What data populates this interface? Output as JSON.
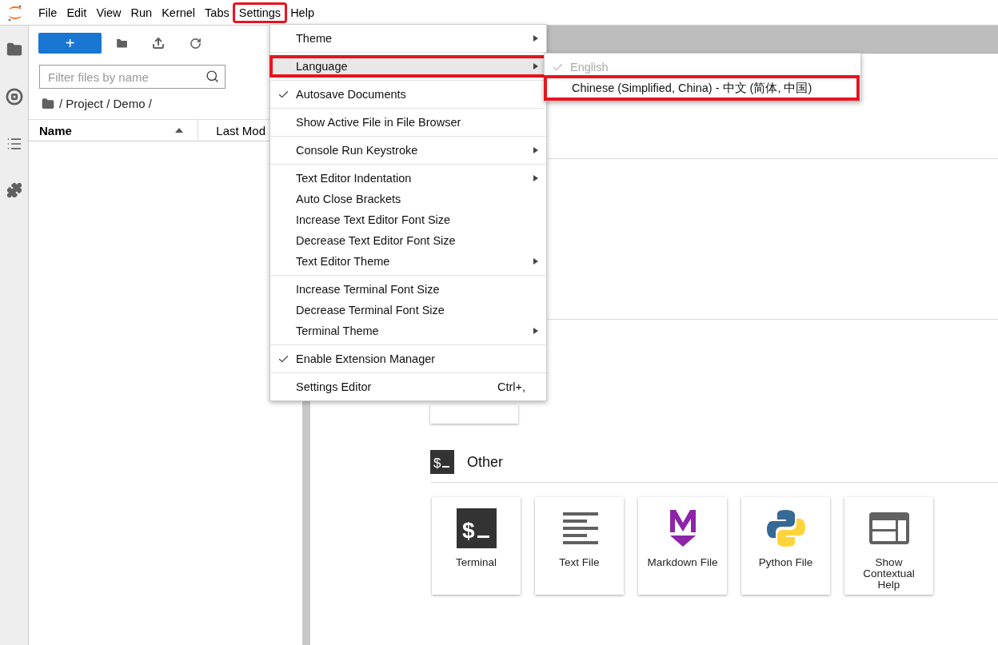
{
  "menubar": [
    {
      "label": "File",
      "highlighted": false
    },
    {
      "label": "Edit",
      "highlighted": false
    },
    {
      "label": "View",
      "highlighted": false
    },
    {
      "label": "Run",
      "highlighted": false
    },
    {
      "label": "Kernel",
      "highlighted": false
    },
    {
      "label": "Tabs",
      "highlighted": false
    },
    {
      "label": "Settings",
      "highlighted": true
    },
    {
      "label": "Help",
      "highlighted": false
    }
  ],
  "file_browser": {
    "new_button": "+",
    "filter": {
      "placeholder": "Filter files by name"
    },
    "breadcrumb": "/ Project / Demo /",
    "columns": [
      "Name",
      "Last Mod"
    ]
  },
  "settings_menu": [
    [
      {
        "label": "Theme",
        "checked": false,
        "submenu": true,
        "highlighted": false
      }
    ],
    [
      {
        "label": "Language",
        "checked": false,
        "submenu": true,
        "highlighted": true
      }
    ],
    [
      {
        "label": "Autosave Documents",
        "checked": true,
        "submenu": false,
        "highlighted": false
      }
    ],
    [
      {
        "label": "Show Active File in File Browser",
        "checked": false,
        "submenu": false,
        "highlighted": false
      }
    ],
    [
      {
        "label": "Console Run Keystroke",
        "checked": false,
        "submenu": true,
        "highlighted": false
      }
    ],
    [
      {
        "label": "Text Editor Indentation",
        "checked": false,
        "submenu": true,
        "highlighted": false
      },
      {
        "label": "Auto Close Brackets",
        "checked": false,
        "submenu": false,
        "highlighted": false
      },
      {
        "label": "Increase Text Editor Font Size",
        "checked": false,
        "submenu": false,
        "highlighted": false
      },
      {
        "label": "Decrease Text Editor Font Size",
        "checked": false,
        "submenu": false,
        "highlighted": false
      },
      {
        "label": "Text Editor Theme",
        "checked": false,
        "submenu": true,
        "highlighted": false
      }
    ],
    [
      {
        "label": "Increase Terminal Font Size",
        "checked": false,
        "submenu": false,
        "highlighted": false
      },
      {
        "label": "Decrease Terminal Font Size",
        "checked": false,
        "submenu": false,
        "highlighted": false
      },
      {
        "label": "Terminal Theme",
        "checked": false,
        "submenu": true,
        "highlighted": false
      }
    ],
    [
      {
        "label": "Enable Extension Manager",
        "checked": true,
        "submenu": false,
        "highlighted": false
      }
    ],
    [
      {
        "label": "Settings Editor",
        "checked": false,
        "submenu": false,
        "highlighted": false,
        "shortcut": "Ctrl+,"
      }
    ]
  ],
  "language_menu": [
    {
      "label": "English",
      "checked": true,
      "disabled": true,
      "highlighted": false
    },
    {
      "label": "Chinese (Simplified, China) - 中文 (简体, 中国)",
      "checked": false,
      "disabled": false,
      "highlighted": true
    }
  ],
  "launcher": {
    "section_icon": "$",
    "section": "Other",
    "cards": [
      {
        "kind": "terminal",
        "label": "Terminal",
        "icon_text": "$"
      },
      {
        "kind": "text",
        "label": "Text File"
      },
      {
        "kind": "markdown",
        "label": "Markdown File"
      },
      {
        "kind": "python",
        "label": "Python File"
      },
      {
        "kind": "help",
        "label": "Show Contextual Help"
      }
    ]
  }
}
